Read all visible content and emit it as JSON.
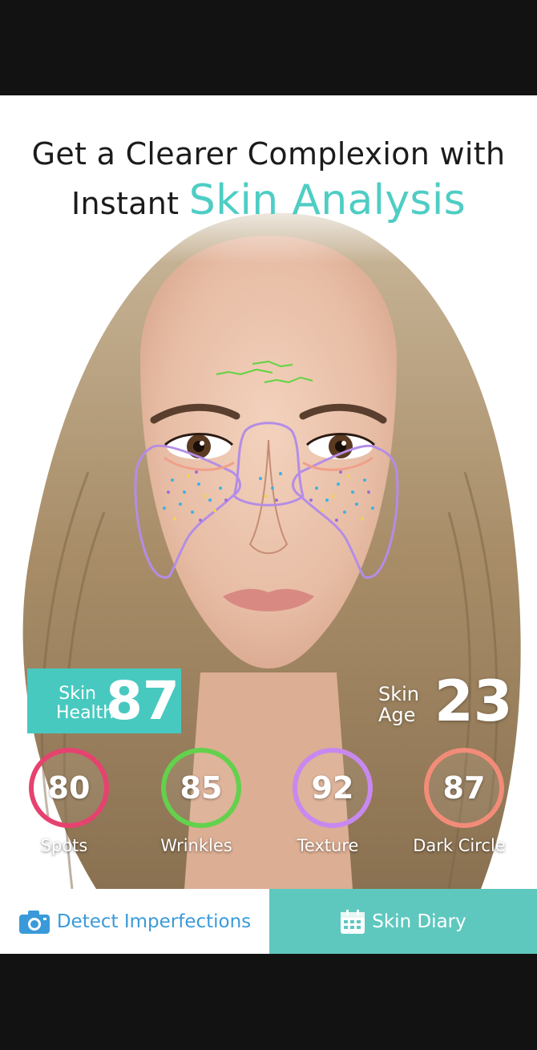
{
  "headline": {
    "line1": "Get a Clearer Complexion with",
    "line2_prefix": "Instant ",
    "line2_accent": "Skin Analysis"
  },
  "scores": {
    "skin_health_label": "Skin Health",
    "skin_health_value": "87",
    "skin_age_label": "Skin Age",
    "skin_age_value": "23"
  },
  "metrics": [
    {
      "label": "Spots",
      "value": "80",
      "color": "#e6426f"
    },
    {
      "label": "Wrinkles",
      "value": "85",
      "color": "#63d14c"
    },
    {
      "label": "Texture",
      "value": "92",
      "color": "#c888f0"
    },
    {
      "label": "Dark Circle",
      "value": "87",
      "color": "#f28c78"
    }
  ],
  "tabs": {
    "detect_label": "Detect Imperfections",
    "diary_label": "Skin Diary"
  },
  "colors": {
    "accent": "#4ecdc4",
    "tab_active_bg": "#5ec8bf",
    "detect_text": "#3a9ad9"
  }
}
